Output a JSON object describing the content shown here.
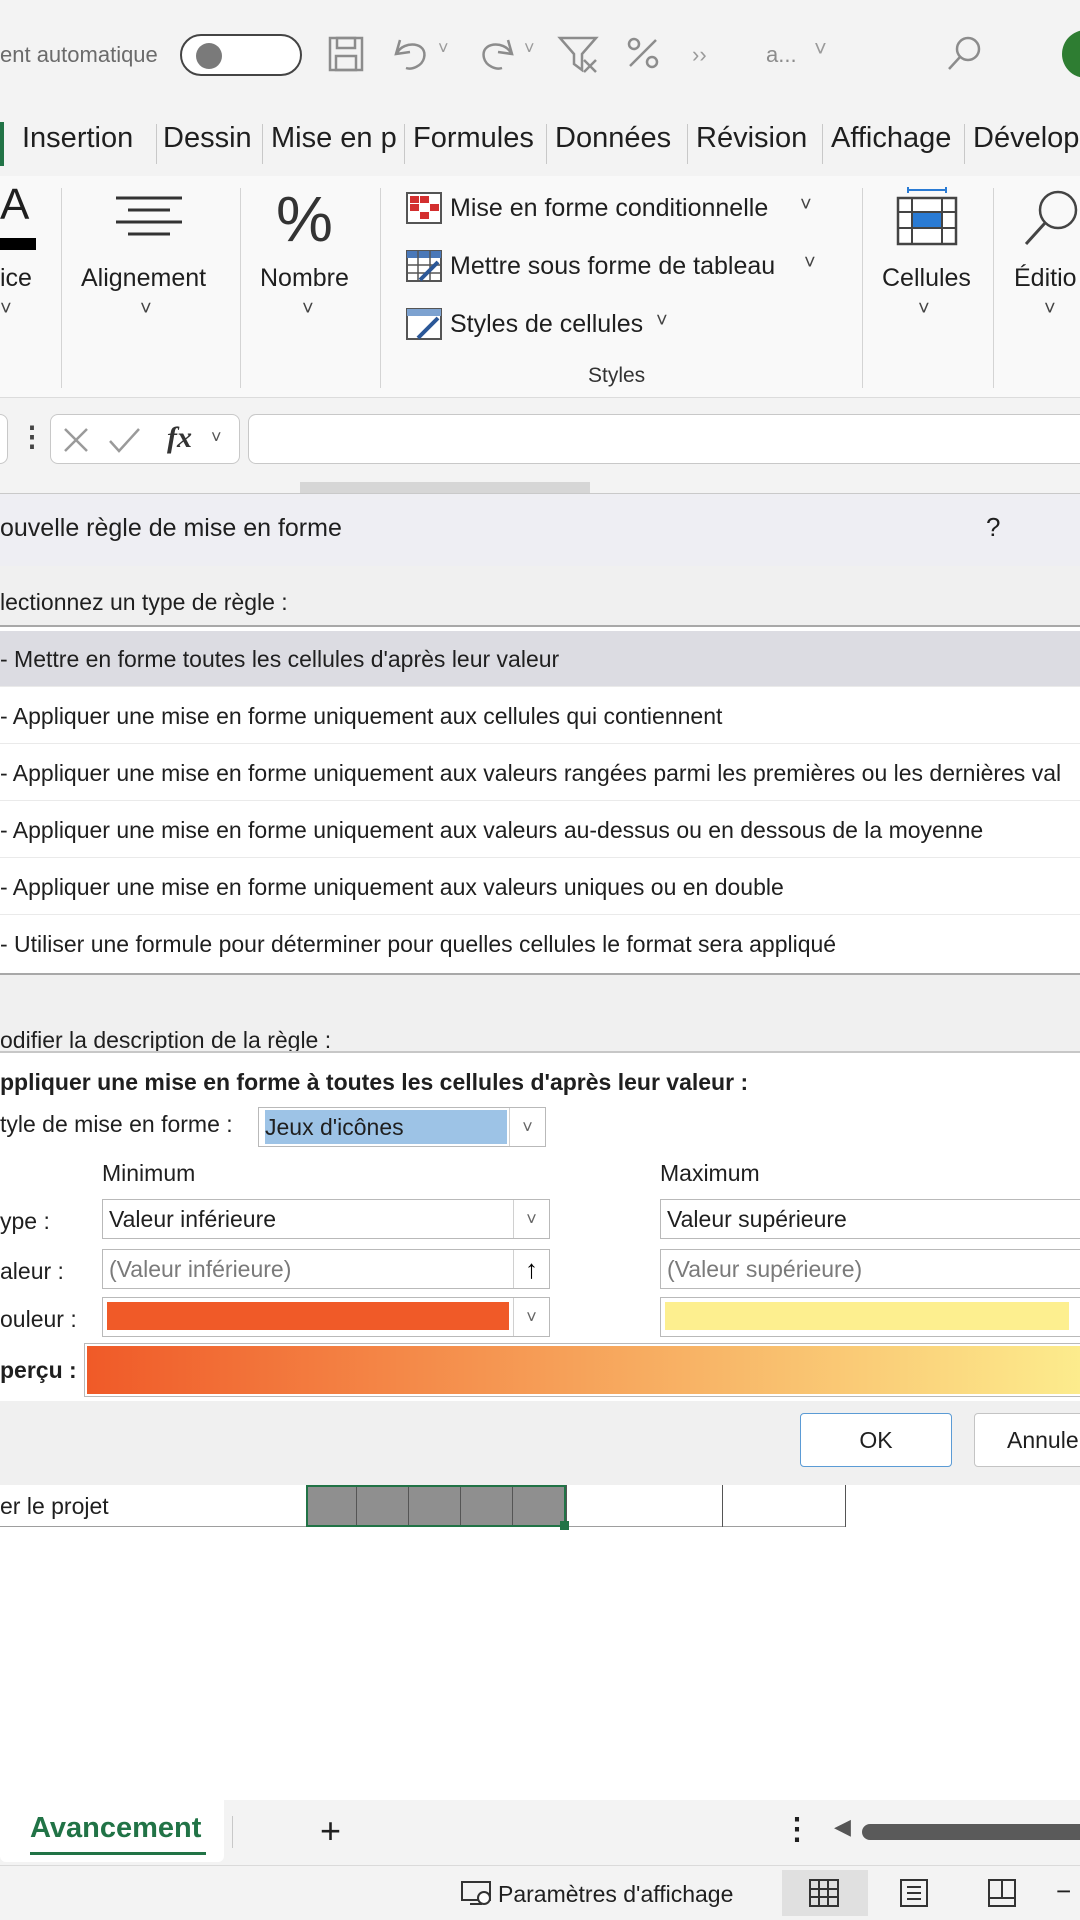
{
  "titlebar": {
    "autosave_label": "ent automatique",
    "overflow_label": "››",
    "search_trunc": "a..."
  },
  "tabs": [
    "Insertion",
    "Dessin",
    "Mise en p",
    "Formules",
    "Données",
    "Révision",
    "Affichage",
    "Dévelop"
  ],
  "ribbon": {
    "police_label": "ice",
    "alignement_label": "Alignement",
    "nombre_label": "Nombre",
    "nombre_icon_glyph": "%",
    "conditional_format_label": "Mise en forme conditionnelle",
    "format_table_label": "Mettre sous forme de tableau",
    "cell_styles_label": "Styles de cellules",
    "styles_group_label": "Styles",
    "cellules_label": "Cellules",
    "edition_label": "Éditio"
  },
  "formula_bar": {
    "fx_label": "fx",
    "value": ""
  },
  "dialog": {
    "title": "ouvelle règle de mise en forme",
    "help": "?",
    "select_type_label": "lectionnez un type de règle :",
    "rule_types": [
      "- Mettre en forme toutes les cellules d'après leur valeur",
      "- Appliquer une mise en forme uniquement aux cellules qui contiennent",
      "- Appliquer une mise en forme uniquement aux valeurs rangées parmi les premières ou les dernières val",
      "- Appliquer une mise en forme uniquement aux valeurs au-dessus ou en dessous de la moyenne",
      "- Appliquer une mise en forme uniquement aux valeurs uniques ou en double",
      "- Utiliser une formule pour déterminer pour quelles cellules le format sera appliqué"
    ],
    "selected_rule_index": 0,
    "edit_desc_label": "odifier la description de la règle :",
    "description_heading": "ppliquer une mise en forme à toutes les cellules d'après leur valeur :",
    "format_style_label": "tyle de mise en forme :",
    "format_style_value": "Jeux d'icônes",
    "minimum_label": "Minimum",
    "maximum_label": "Maximum",
    "type_label": "ype :",
    "valeur_label": "aleur :",
    "couleur_label": "ouleur :",
    "apercu_label": "perçu :",
    "min_type": "Valeur inférieure",
    "max_type": "Valeur supérieure",
    "min_value_placeholder": "(Valeur inférieure)",
    "max_value_placeholder": "(Valeur supérieure)",
    "min_color": "#f05a28",
    "max_color": "#fdef8f",
    "ok_label": "OK",
    "cancel_label": "Annule"
  },
  "sheet": {
    "row_text": "er le projet"
  },
  "sheet_tabs": {
    "active_tab": "Avancement",
    "add_glyph": "+"
  },
  "status_bar": {
    "display_settings": "Paramètres d'affichage"
  }
}
